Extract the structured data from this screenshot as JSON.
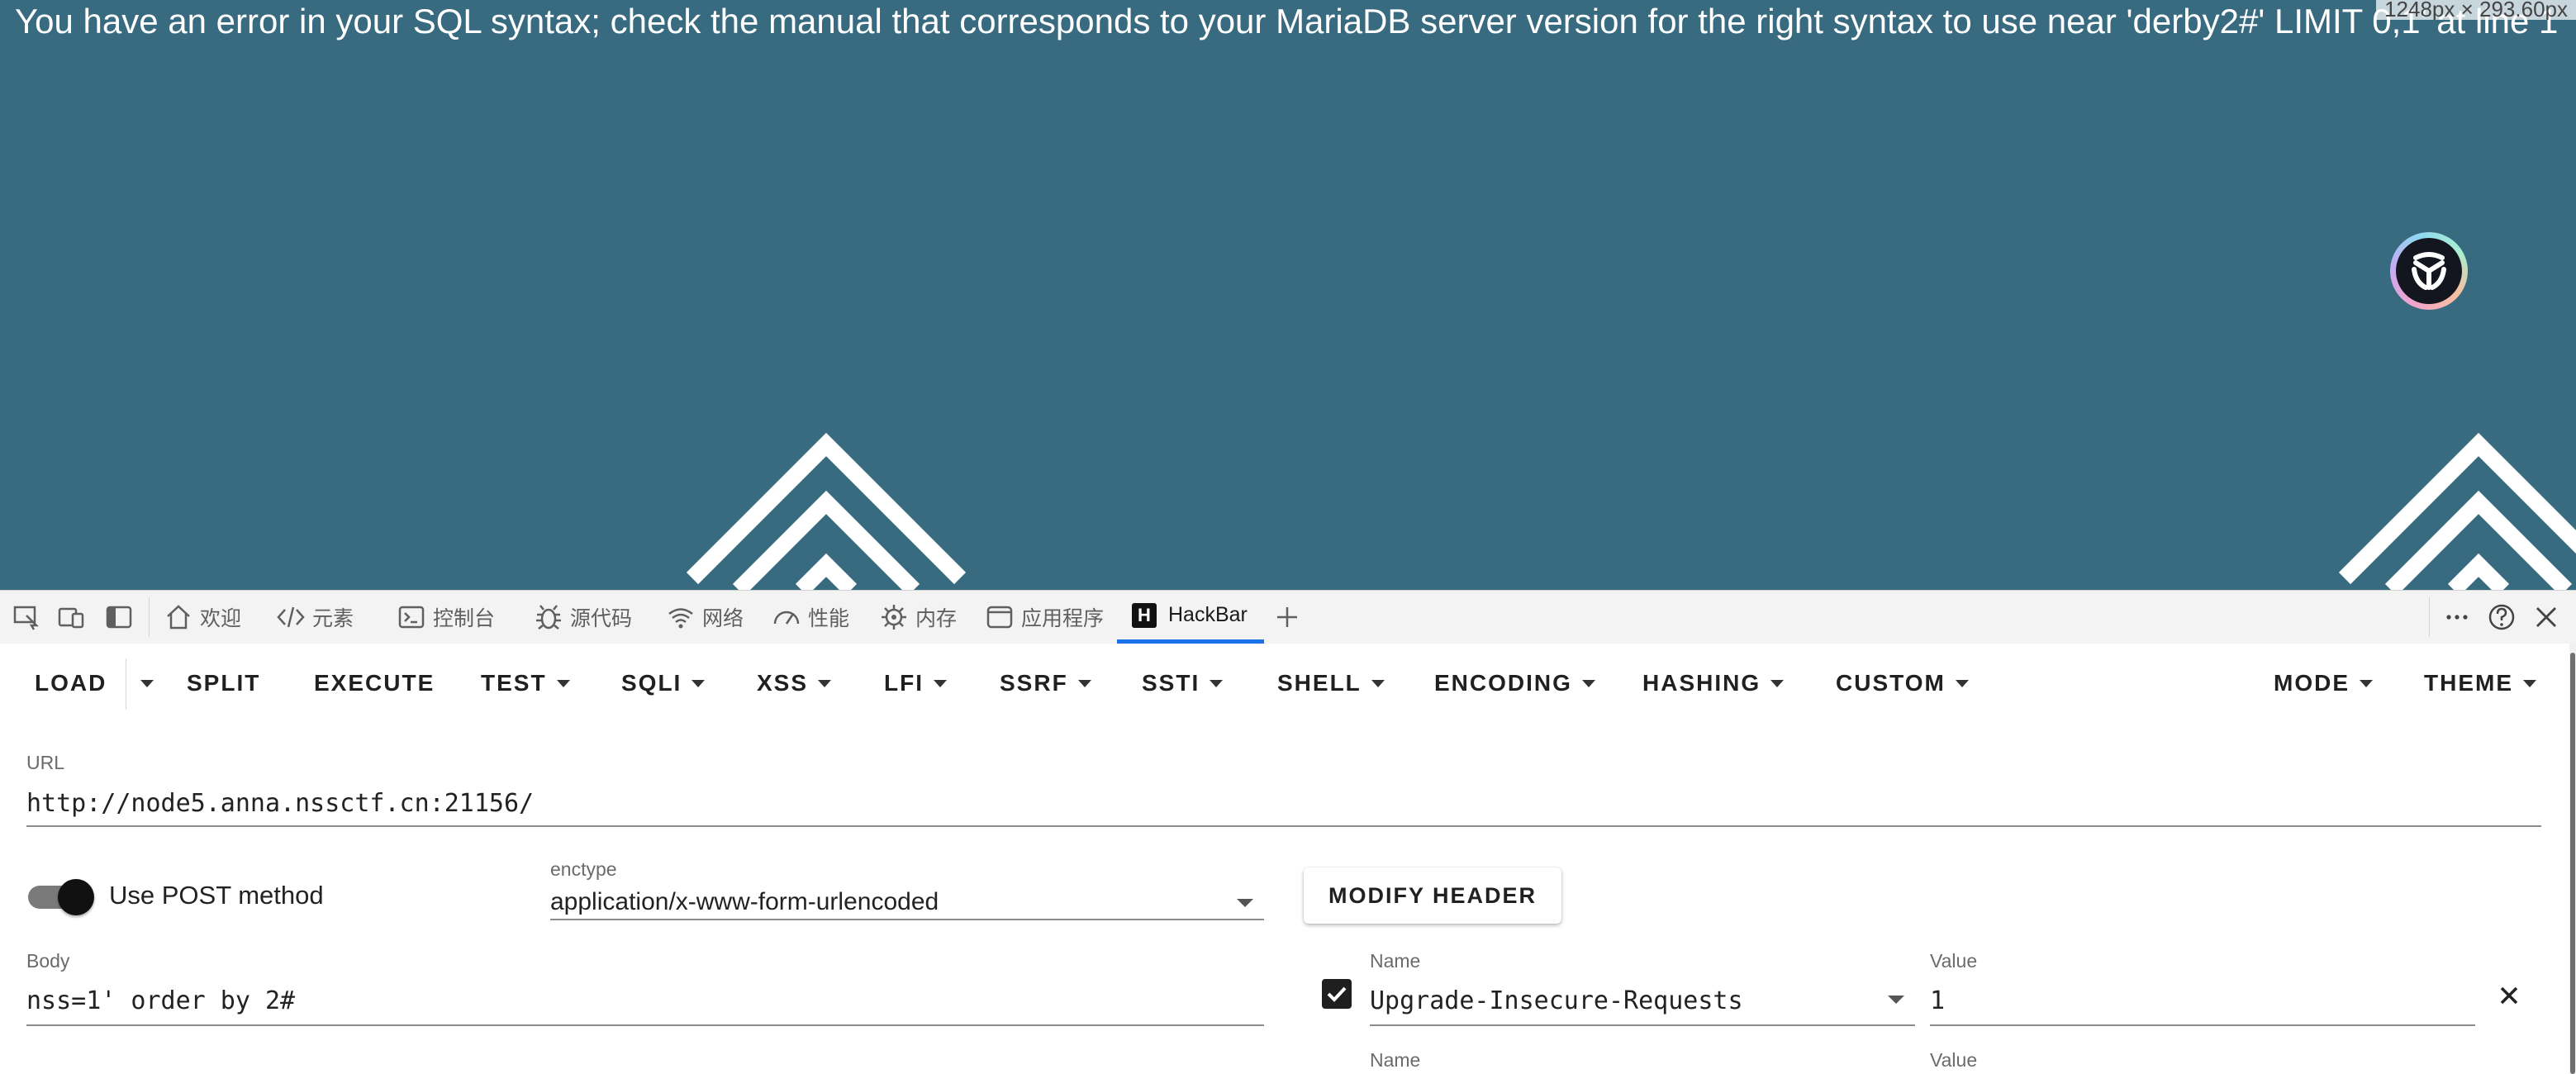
{
  "viewport": {
    "error_message": "You have an error in your SQL syntax; check the manual that corresponds to your MariaDB server version for the right syntax to use near 'derby2#' LIMIT 0,1' at line 1",
    "element_size_label": "1248px × 293.60px",
    "background_color": "#386a80"
  },
  "devtools": {
    "tabs": [
      {
        "label": "欢迎",
        "icon": "home-icon"
      },
      {
        "label": "元素",
        "icon": "code-icon"
      },
      {
        "label": "控制台",
        "icon": "console-icon"
      },
      {
        "label": "源代码",
        "icon": "bug-icon"
      },
      {
        "label": "网络",
        "icon": "wifi-icon"
      },
      {
        "label": "性能",
        "icon": "gauge-icon"
      },
      {
        "label": "内存",
        "icon": "chip-icon"
      },
      {
        "label": "应用程序",
        "icon": "app-window-icon"
      },
      {
        "label": "HackBar",
        "icon": "hackbar-logo-icon",
        "active": true
      }
    ],
    "active_tab_color": "#1a73e8"
  },
  "hackbar": {
    "menu": {
      "load": "LOAD",
      "split": "SPLIT",
      "execute": "EXECUTE",
      "test": "TEST",
      "sqli": "SQLI",
      "xss": "XSS",
      "lfi": "LFI",
      "ssrf": "SSRF",
      "ssti": "SSTI",
      "shell": "SHELL",
      "encoding": "ENCODING",
      "hashing": "HASHING",
      "custom": "CUSTOM",
      "mode": "MODE",
      "theme": "THEME"
    },
    "url": {
      "label": "URL",
      "value": "http://node5.anna.nssctf.cn:21156/"
    },
    "post_toggle": {
      "label": "Use POST method",
      "enabled": true
    },
    "enctype": {
      "label": "enctype",
      "value": "application/x-www-form-urlencoded"
    },
    "modify_header_label": "MODIFY HEADER",
    "body": {
      "label": "Body",
      "value": "nss=1' order by 2#"
    },
    "headers": [
      {
        "name_label": "Name",
        "name": "Upgrade-Insecure-Requests",
        "value_label": "Value",
        "value": "1",
        "checked": true
      },
      {
        "name_label": "Name",
        "name": "",
        "value_label": "Value",
        "value": ""
      }
    ]
  }
}
